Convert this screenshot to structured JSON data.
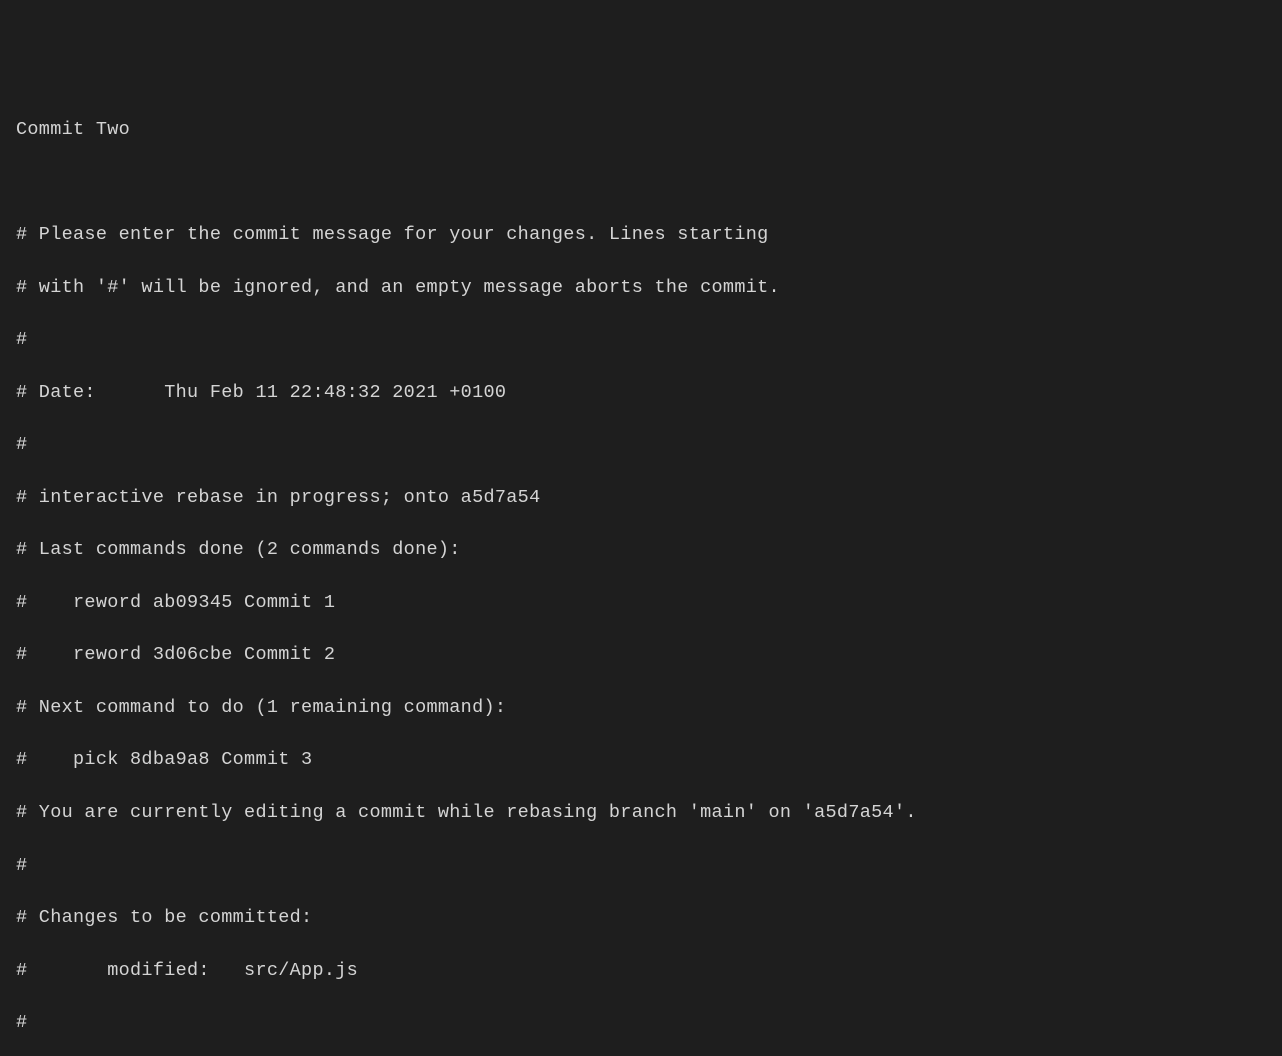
{
  "editor": {
    "commit_message": "Commit Two",
    "lines": [
      "# Please enter the commit message for your changes. Lines starting",
      "# with '#' will be ignored, and an empty message aborts the commit.",
      "#",
      "# Date:      Thu Feb 11 22:48:32 2021 +0100",
      "#",
      "# interactive rebase in progress; onto a5d7a54",
      "# Last commands done (2 commands done):",
      "#    reword ab09345 Commit 1",
      "#    reword 3d06cbe Commit 2",
      "# Next command to do (1 remaining command):",
      "#    pick 8dba9a8 Commit 3",
      "# You are currently editing a commit while rebasing branch 'main' on 'a5d7a54'.",
      "#",
      "# Changes to be committed:",
      "#       modified:   src/App.js",
      "#"
    ]
  }
}
